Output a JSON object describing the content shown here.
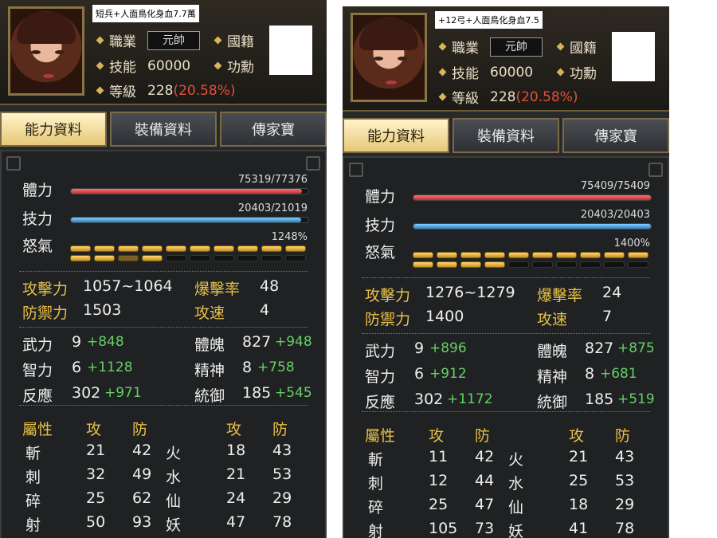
{
  "panels": [
    {
      "caption": "短兵+人面鳥化身血7.7萬",
      "job_label": "職業",
      "job_value": "元帥",
      "nation_label": "國籍",
      "skill_label": "技能",
      "skill_value": "60000",
      "merit_label": "功勳",
      "level_label": "等級",
      "level_value": "228",
      "level_pct": "(20.58%)",
      "tabs": [
        "能力資料",
        "裝備資料",
        "傳家寶"
      ],
      "hp_label": "體力",
      "hp_text": "75319/77376",
      "hp_fraction": 0.973,
      "sp_label": "技力",
      "sp_text": "20403/21019",
      "sp_fraction": 0.971,
      "rage_label": "怒氣",
      "rage_text": "1248%",
      "rage_segments": [
        1,
        1,
        1,
        1,
        1,
        1,
        1,
        1,
        1,
        1,
        1,
        1,
        2,
        1,
        0,
        0,
        0,
        0,
        0,
        0
      ],
      "atk_label": "攻擊力",
      "atk": "1057~1064",
      "crit_label": "爆擊率",
      "crit": "48",
      "def_label": "防禦力",
      "def": "1503",
      "spd_label": "攻速",
      "spd": "4",
      "attrs": [
        {
          "label": "武力",
          "base": "9",
          "bonus": "+848",
          "label2": "體魄",
          "base2": "827",
          "bonus2": "+948"
        },
        {
          "label": "智力",
          "base": "6",
          "bonus": "+1128",
          "label2": "精神",
          "base2": "8",
          "bonus2": "+758"
        },
        {
          "label": "反應",
          "base": "302",
          "bonus": "+971",
          "label2": "統御",
          "base2": "185",
          "bonus2": "+545"
        }
      ],
      "elem_header": [
        "屬性",
        "攻",
        "防",
        "攻",
        "防"
      ],
      "elem_rows": [
        {
          "a": "斬",
          "a_atk": "21",
          "a_def": "42",
          "b": "火",
          "b_atk": "18",
          "b_def": "43"
        },
        {
          "a": "刺",
          "a_atk": "32",
          "a_def": "49",
          "b": "水",
          "b_atk": "21",
          "b_def": "53"
        },
        {
          "a": "碎",
          "a_atk": "25",
          "a_def": "62",
          "b": "仙",
          "b_atk": "24",
          "b_def": "29"
        },
        {
          "a": "射",
          "a_atk": "50",
          "a_def": "93",
          "b": "妖",
          "b_atk": "47",
          "b_def": "78"
        }
      ]
    },
    {
      "caption": "+12弓+人面鳥化身血7.5",
      "job_label": "職業",
      "job_value": "元帥",
      "nation_label": "國籍",
      "skill_label": "技能",
      "skill_value": "60000",
      "merit_label": "功勳",
      "level_label": "等級",
      "level_value": "228",
      "level_pct": "(20.58%)",
      "tabs": [
        "能力資料",
        "裝備資料",
        "傳家寶"
      ],
      "hp_label": "體力",
      "hp_text": "75409/75409",
      "hp_fraction": 1.0,
      "sp_label": "技力",
      "sp_text": "20403/20403",
      "sp_fraction": 1.0,
      "rage_label": "怒氣",
      "rage_text": "1400%",
      "rage_segments": [
        1,
        1,
        1,
        1,
        1,
        1,
        1,
        1,
        1,
        1,
        1,
        1,
        1,
        1,
        0,
        0,
        0,
        0,
        0,
        0
      ],
      "atk_label": "攻擊力",
      "atk": "1276~1279",
      "crit_label": "爆擊率",
      "crit": "24",
      "def_label": "防禦力",
      "def": "1400",
      "spd_label": "攻速",
      "spd": "7",
      "attrs": [
        {
          "label": "武力",
          "base": "9",
          "bonus": "+896",
          "label2": "體魄",
          "base2": "827",
          "bonus2": "+875"
        },
        {
          "label": "智力",
          "base": "6",
          "bonus": "+912",
          "label2": "精神",
          "base2": "8",
          "bonus2": "+681"
        },
        {
          "label": "反應",
          "base": "302",
          "bonus": "+1172",
          "label2": "統御",
          "base2": "185",
          "bonus2": "+519"
        }
      ],
      "elem_header": [
        "屬性",
        "攻",
        "防",
        "攻",
        "防"
      ],
      "elem_rows": [
        {
          "a": "斬",
          "a_atk": "11",
          "a_def": "42",
          "b": "火",
          "b_atk": "21",
          "b_def": "43"
        },
        {
          "a": "刺",
          "a_atk": "12",
          "a_def": "44",
          "b": "水",
          "b_atk": "25",
          "b_def": "53"
        },
        {
          "a": "碎",
          "a_atk": "25",
          "a_def": "47",
          "b": "仙",
          "b_atk": "18",
          "b_def": "29"
        },
        {
          "a": "射",
          "a_atk": "105",
          "a_def": "73",
          "b": "妖",
          "b_atk": "41",
          "b_def": "78"
        }
      ]
    }
  ],
  "colors": {
    "gold_label": "#e8c048",
    "bonus_green": "#66d066",
    "hp_red": "#e04848",
    "sp_blue": "#48a8e0",
    "level_pct": "#e0503a"
  }
}
